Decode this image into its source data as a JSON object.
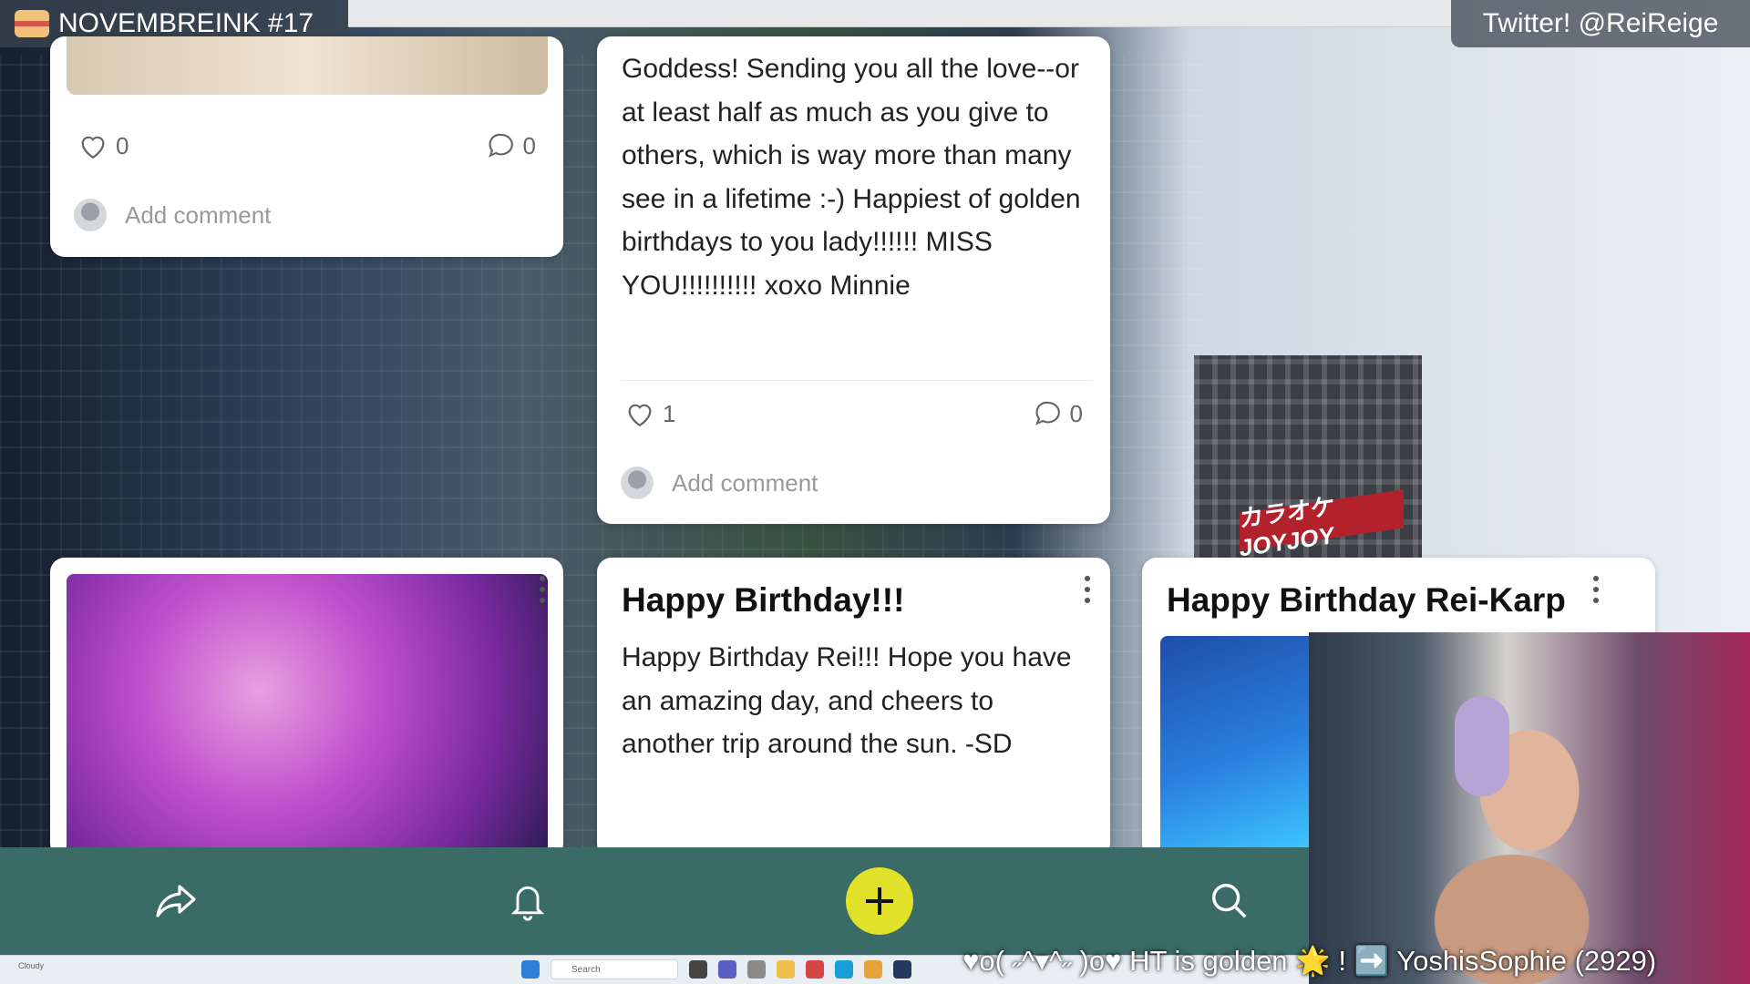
{
  "overlay": {
    "title": "NOVEMBREINK #17",
    "twitter": "Twitter! @ReiReige",
    "ticker": "♥o( ˶^▾^˶ )o♥ HT is golden 🌟 ! ➡️ YoshisSophie (2929)"
  },
  "cards": {
    "card_a": {
      "likes": "0",
      "comments": "0",
      "add_comment": "Add comment"
    },
    "card_b": {
      "body": "Goddess! Sending you all the love--or at least half as much as you give to others, which is way more than many see in a lifetime :-) Happiest of golden birthdays to you lady!!!!!! MISS YOU!!!!!!!!!! xoxo Minnie",
      "likes": "1",
      "comments": "0",
      "add_comment": "Add comment"
    },
    "card_d": {
      "title": "Happy Birthday!!!",
      "body": "Happy Birthday Rei!!! Hope you have an amazing day, and cheers to another trip around the sun. -SD"
    },
    "card_e": {
      "title": "Happy Birthday Rei-Karp"
    }
  },
  "background": {
    "sign": "カラオケJOYJOY"
  },
  "taskbar": {
    "search_placeholder": "Search",
    "weather": "Cloudy"
  },
  "colors": {
    "nav_bg": "#3a6b66",
    "add_button": "#e1e12a"
  },
  "icons": {
    "share": "share-icon",
    "bell": "bell-icon",
    "add": "plus-icon",
    "search": "search-icon"
  }
}
